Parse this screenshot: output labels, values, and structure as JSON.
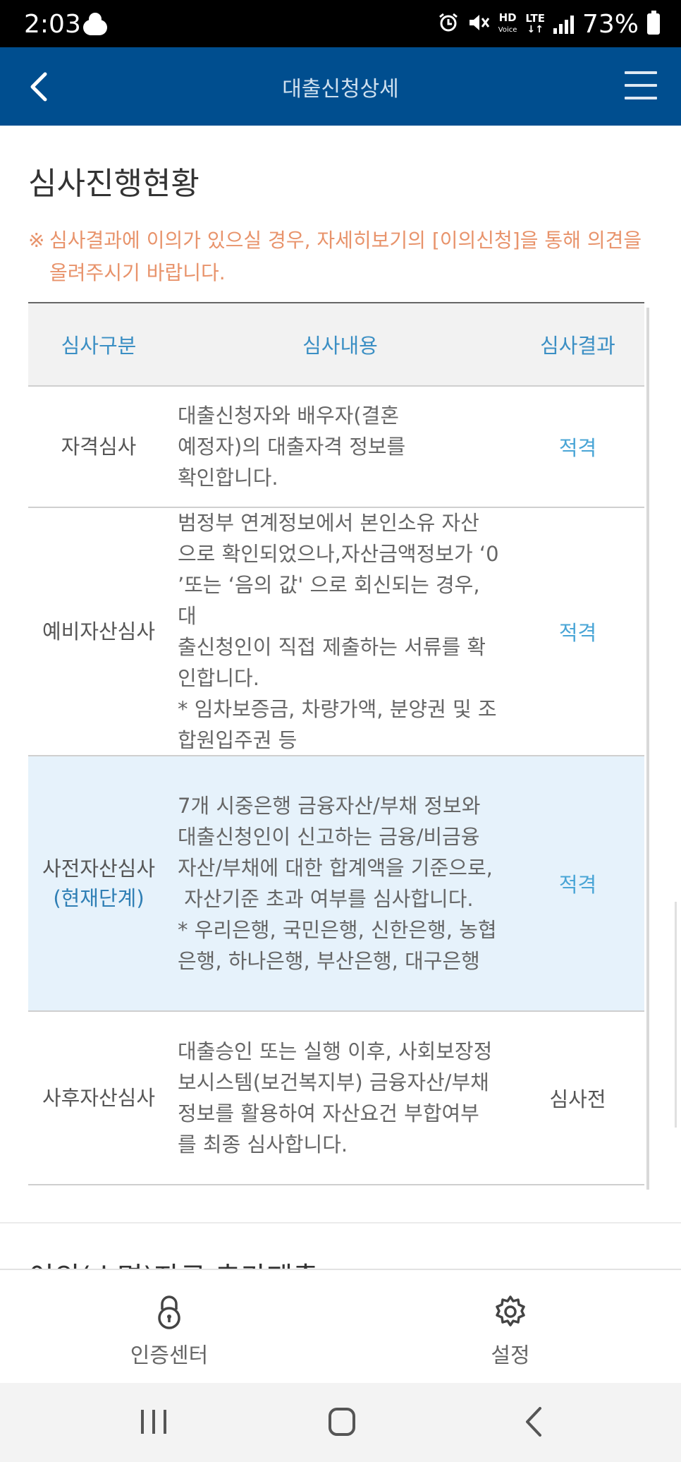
{
  "status_bar": {
    "time": "2:03",
    "net_label_top": "HD",
    "net_label_bottom": "Voice",
    "lte_label": "LTE",
    "battery": "73%",
    "icons": [
      "cloud-icon",
      "alarm-icon",
      "mute-icon",
      "signal-icon",
      "battery-icon"
    ]
  },
  "header": {
    "title": "대출신청상세",
    "back_icon": "chevron-left-icon",
    "menu_icon": "hamburger-menu-icon",
    "background_color": "#004e8f"
  },
  "section": {
    "title": "심사진행현황",
    "notice_mark": "※",
    "notice_text": "심사결과에 이의가 있으실 경우, 자세히보기의 [이의신청]을 통해 의견을 올려주시기 바랍니다.",
    "notice_color": "#e8936b"
  },
  "table": {
    "headers": {
      "type": "심사구분",
      "content": "심사내용",
      "result": "심사결과"
    },
    "rows": [
      {
        "type": "자격심사",
        "stage": "",
        "content_lines": [
          "대출신청자와 배우자(결혼",
          "예정자)의 대출자격 정보를",
          "확인합니다."
        ],
        "result": "적격",
        "highlight": false
      },
      {
        "type": "예비자산심사",
        "stage": "",
        "content_lines": [
          "범정부 연계정보에서 본인소유 자산",
          "으로 확인되었으나,자산금액정보가 ‘0",
          "’또는 ‘음의 값' 으로 회신되는 경우, 대",
          "출신청인이 직접 제출하는 서류를 확",
          "인합니다.",
          "* 임차보증금, 차량가액, 분양권 및 조",
          "합원입주권 등"
        ],
        "result": "적격",
        "highlight": false
      },
      {
        "type": "사전자산심사",
        "stage": "(현재단계)",
        "content_lines": [
          "7개 시중은행 금융자산/부채 정보와",
          "대출신청인이 신고하는 금융/비금융",
          "자산/부채에 대한 합계액을 기준으로,",
          " 자산기준 초과 여부를 심사합니다.",
          "* 우리은행, 국민은행, 신한은행, 농협",
          "은행, 하나은행, 부산은행, 대구은행"
        ],
        "result": "적격",
        "highlight": true
      },
      {
        "type": "사후자산심사",
        "stage": "",
        "content_lines": [
          "대출승인 또는 실행 이후, 사회보장정",
          "보시스템(보건복지부) 금융자산/부채",
          "정보를 활용하여 자산요건 부합여부",
          "를 최종 심사합니다."
        ],
        "result": "심사전",
        "highlight": false
      }
    ]
  },
  "next_section": {
    "title_partial": "이의(소명)자료 추가제출"
  },
  "bottom_nav": {
    "items": [
      {
        "label": "인증센터",
        "icon": "lock-icon"
      },
      {
        "label": "설정",
        "icon": "gear-icon"
      }
    ]
  },
  "system_nav": {
    "icons": [
      "recent-apps-icon",
      "home-icon",
      "back-icon"
    ]
  }
}
